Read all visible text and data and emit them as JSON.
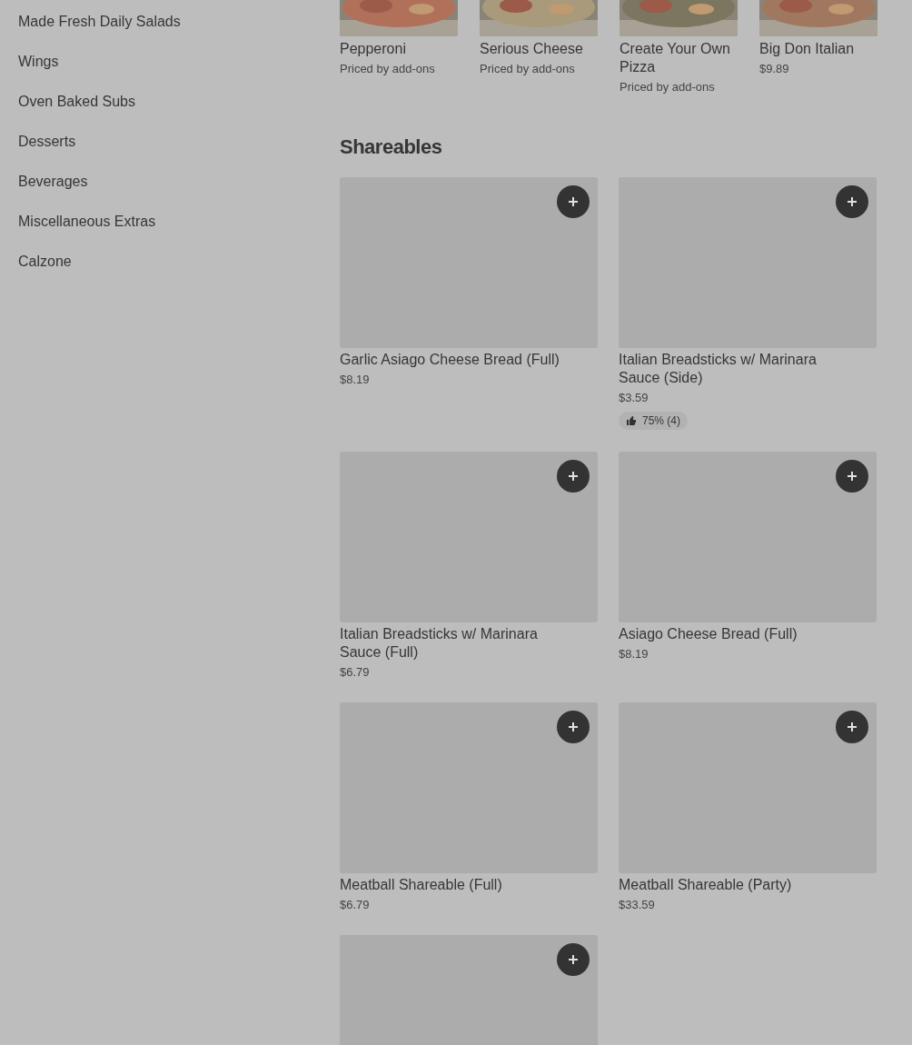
{
  "sidebar": {
    "items": [
      {
        "label": "Made Fresh Daily Salads"
      },
      {
        "label": "Wings"
      },
      {
        "label": "Oven Baked Subs"
      },
      {
        "label": "Desserts"
      },
      {
        "label": "Beverages"
      },
      {
        "label": "Miscellaneous Extras"
      },
      {
        "label": "Calzone"
      }
    ]
  },
  "featured": [
    {
      "name": "Pepperoni",
      "price": "Priced by add-ons"
    },
    {
      "name": "Serious Cheese",
      "price": "Priced by add-ons"
    },
    {
      "name": "Create Your Own Pizza",
      "price": "Priced by add-ons"
    },
    {
      "name": "Big Don Italian",
      "price": "$9.89"
    }
  ],
  "section": {
    "title": "Shareables",
    "items": [
      {
        "name": "Garlic Asiago Cheese Bread (Full)",
        "price": "$8.19"
      },
      {
        "name": "Italian Breadsticks w/ Marinara Sauce (Side)",
        "price": "$3.59",
        "rating": "75% (4)"
      },
      {
        "name": "Italian Breadsticks w/ Marinara Sauce (Full)",
        "price": "$6.79"
      },
      {
        "name": "Asiago Cheese Bread (Full)",
        "price": "$8.19"
      },
      {
        "name": "Meatball Shareable (Full)",
        "price": "$6.79"
      },
      {
        "name": "Meatball Shareable (Party)",
        "price": "$33.59"
      }
    ]
  }
}
